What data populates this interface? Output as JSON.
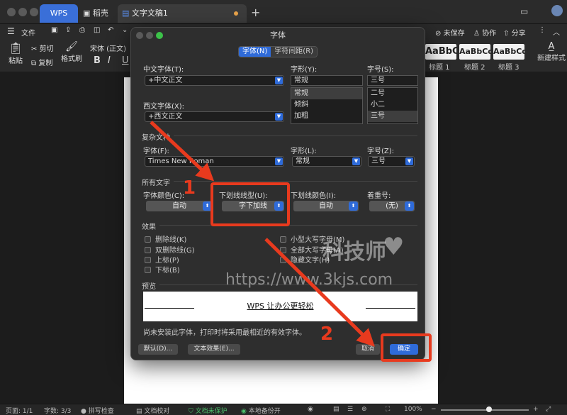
{
  "tabs": [
    {
      "label": "WPS"
    },
    {
      "label": "稻壳"
    },
    {
      "label": "文字文稿1"
    }
  ],
  "toolbar": {
    "file_label": "文件",
    "unsaved_label": "未保存",
    "collab_label": "协作",
    "share_label": "分享",
    "paste_label": "粘贴",
    "cut_label": "剪切",
    "copy_label": "复制",
    "format_painter_label": "格式刷",
    "font_name": "宋体 (正文)",
    "bold": "B",
    "italic": "I",
    "underline": "U",
    "styles": [
      {
        "preview": "AaBbC",
        "label": "标题 1"
      },
      {
        "preview": "AaBbCc",
        "label": "标题 2"
      },
      {
        "preview": "AaBbCc",
        "label": "标题 3"
      }
    ],
    "new_style_label": "新建样式"
  },
  "dialog": {
    "title": "字体",
    "tab_font": "字体(N)",
    "tab_spacing": "字符间距(R)",
    "cn_font_label": "中文字体(T):",
    "cn_font_value": "+中文正文",
    "style_label": "字形(Y):",
    "style_value": "常规",
    "style_options": [
      "常规",
      "倾斜",
      "加粗"
    ],
    "size_label": "字号(S):",
    "size_value": "三号",
    "size_options": [
      "二号",
      "小二",
      "三号"
    ],
    "west_font_label": "西文字体(X):",
    "west_font_value": "+西文正文",
    "complex_section": "复杂文种",
    "complex_font_label": "字体(F):",
    "complex_font_value": "Times New Roman",
    "complex_style_label": "字形(L):",
    "complex_style_value": "常规",
    "complex_size_label": "字号(Z):",
    "complex_size_value": "三号",
    "all_text_section": "所有文字",
    "font_color_label": "字体颜色(C):",
    "font_color_value": "自动",
    "underline_type_label": "下划线线型(U):",
    "underline_type_value": "字下加线",
    "underline_color_label": "下划线颜色(I):",
    "underline_color_value": "自动",
    "emphasis_label": "着重号:",
    "emphasis_value": "(无)",
    "effects_section": "效果",
    "effects_left": [
      "删除线(K)",
      "双删除线(G)",
      "上标(P)",
      "下标(B)"
    ],
    "effects_right": [
      "小型大写字母(M)",
      "全部大写字母(A)",
      "隐藏文字(H)"
    ],
    "preview_section": "预览",
    "preview_text": "WPS 让办公更轻松",
    "notice": "尚未安装此字体，打印时将采用最相近的有效字体。",
    "default_btn": "默认(D)...",
    "text_effects_btn": "文本效果(E)...",
    "cancel_btn": "取消",
    "ok_btn": "确定"
  },
  "statusbar": {
    "page": "页面: 1/1",
    "words": "字数: 3/3",
    "spell": "拼写检查",
    "proofread": "文档校对",
    "protect": "文档未保护",
    "backup": "本地备份开",
    "zoom": "100%"
  },
  "annotations": {
    "step1": "1",
    "step2": "2",
    "watermark_text": "科技师",
    "watermark_url": "https://www.3kjs.com"
  },
  "colors": {
    "accent": "#2f6bd9",
    "annotation_red": "#e83a1e",
    "unsaved_dot": "#e8a34a"
  }
}
